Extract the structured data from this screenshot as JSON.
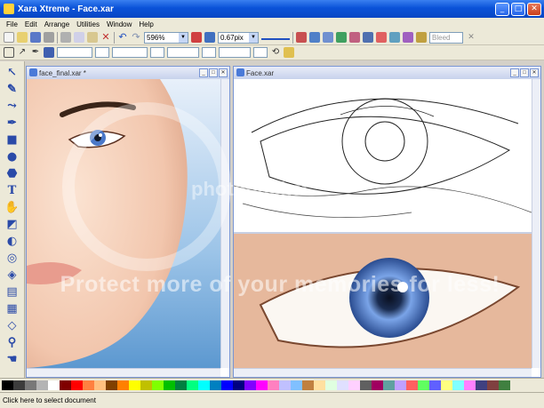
{
  "window": {
    "title": "Xara Xtreme - Face.xar",
    "minimize": "_",
    "maximize": "□",
    "close": "✕"
  },
  "menu": {
    "items": [
      "File",
      "Edit",
      "Arrange",
      "Utilities",
      "Window",
      "Help"
    ]
  },
  "toolbar": {
    "zoom_value": "596%",
    "line_width_value": "0.67pix",
    "blend_value": "Bleed"
  },
  "docs": {
    "left": {
      "title": "face_final.xar *"
    },
    "right": {
      "title": "Face.xar"
    }
  },
  "watermark": {
    "text": "Protect more of your memories for less!",
    "brand": "photobucket"
  },
  "status": {
    "text": "Click here to select document"
  },
  "tools": [
    {
      "name": "selector-tool",
      "glyph": "↖"
    },
    {
      "name": "freehand-tool",
      "glyph": "✎"
    },
    {
      "name": "shape-editor-tool",
      "glyph": "⤳"
    },
    {
      "name": "pen-tool",
      "glyph": "✒"
    },
    {
      "name": "rectangle-tool",
      "glyph": "■"
    },
    {
      "name": "ellipse-tool",
      "glyph": "●"
    },
    {
      "name": "quickshape-tool",
      "glyph": "⬣"
    },
    {
      "name": "text-tool",
      "glyph": "T"
    },
    {
      "name": "push-tool",
      "glyph": "✋"
    },
    {
      "name": "fill-tool",
      "glyph": "◩"
    },
    {
      "name": "transparency-tool",
      "glyph": "◐"
    },
    {
      "name": "contour-tool",
      "glyph": "◎"
    },
    {
      "name": "bevel-tool",
      "glyph": "◈"
    },
    {
      "name": "shadow-tool",
      "glyph": "▤"
    },
    {
      "name": "mould-tool",
      "glyph": "▦"
    },
    {
      "name": "blend-tool",
      "glyph": "◇"
    },
    {
      "name": "zoom-tool",
      "glyph": "⚲"
    },
    {
      "name": "push-hand-tool",
      "glyph": "☚"
    }
  ],
  "colors": {
    "accent": "#0a52d8",
    "swatches": [
      "#000000",
      "#3c3c3c",
      "#787878",
      "#b4b4b4",
      "#ffffff",
      "#800000",
      "#ff0000",
      "#ff8040",
      "#ffc080",
      "#804000",
      "#ff8000",
      "#ffff00",
      "#c0c000",
      "#80ff00",
      "#00c000",
      "#008040",
      "#00ff80",
      "#00ffff",
      "#0080c0",
      "#0000ff",
      "#000080",
      "#8000ff",
      "#ff00ff",
      "#ff80c0",
      "#c0c0ff",
      "#80c0ff",
      "#c08040",
      "#ffe0a0",
      "#e0ffe0",
      "#e0e0ff",
      "#ffd0ff",
      "#606060",
      "#a00060",
      "#60a0a0",
      "#c0a0ff",
      "#ff6060",
      "#60ff60",
      "#6060ff",
      "#ffff80",
      "#80ffff",
      "#ff80ff",
      "#404080",
      "#804040",
      "#408040"
    ]
  }
}
